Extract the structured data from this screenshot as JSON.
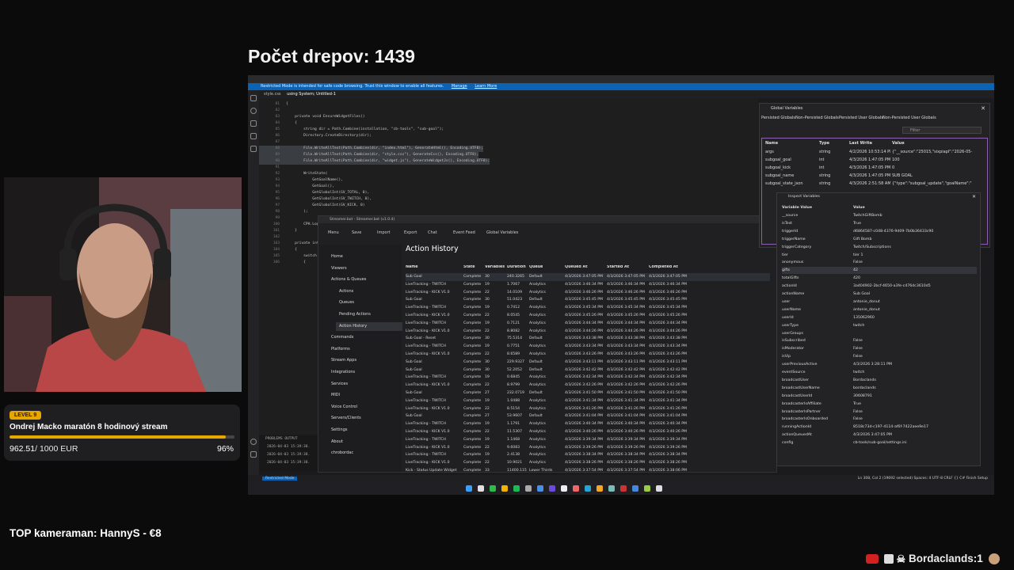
{
  "overlay": {
    "title": "Počet drepov: 1439",
    "goal": {
      "level": "LEVEL 9",
      "title": "Ondrej Macko maratón 8 hodinový stream",
      "amount": "962.51",
      "target": "/ 1000 EUR",
      "percent": "96%",
      "progress_fraction": 0.9625
    },
    "top_cameraman": "TOP kameraman: HannyS - €8",
    "chat": {
      "user": "Bordaclands",
      "count": ":1"
    }
  },
  "vscode": {
    "restricted_banner": "Restricted Mode is intended for safe code browsing. Trust this window to enable all features.",
    "banner_manage": "Manage",
    "banner_learn": "Learn More",
    "tab1": "style.css",
    "tab2": "using System; Untitled-1",
    "status_mode": "Restricted Mode",
    "status_right": "Ln 308, Col 2 (19692 selected)   Spaces: 4   UTF-8   CRLF   {} C#   Finish Setup",
    "panel_tabs": "PROBLEMS   OUTPUT",
    "code_lines": [
      {
        "n": "81",
        "t": "{"
      },
      {
        "n": "82",
        "t": ""
      },
      {
        "n": "83",
        "t": "    private void EnsureWidgetFiles()"
      },
      {
        "n": "84",
        "t": "    {"
      },
      {
        "n": "85",
        "t": "        string dir = Path.Combine(installation, \"cb-tools\", \"sub-goal\");"
      },
      {
        "n": "86",
        "t": "        Directory.CreateDirectory(dir);"
      },
      {
        "n": "87",
        "t": ""
      },
      {
        "n": "88",
        "t": "        File.WriteAllText(Path.Combine(dir, \"index.html\"), GenerateHtml(), Encoding.UTF8);"
      },
      {
        "n": "89",
        "t": "        File.WriteAllText(Path.Combine(dir, \"style.css\"), GenerateCss(), Encoding.UTF8);"
      },
      {
        "n": "90",
        "t": "        File.WriteAllText(Path.Combine(dir, \"widget.js\"), GenerateWidgetJs(), Encoding.UTF8);"
      },
      {
        "n": "91",
        "t": ""
      },
      {
        "n": "92",
        "t": "        WriteState("
      },
      {
        "n": "93",
        "t": "            GetGoalName(),"
      },
      {
        "n": "94",
        "t": "            GetGoal(),"
      },
      {
        "n": "95",
        "t": "            GetGlobalInt(GV_TOTAL, 0),"
      },
      {
        "n": "96",
        "t": "            GetGlobalInt(GV_TWITCH, 0),"
      },
      {
        "n": "97",
        "t": "            GetGlobalInt(GV_KICK, 0)"
      },
      {
        "n": "98",
        "t": "        );"
      },
      {
        "n": "99",
        "t": ""
      },
      {
        "n": "100",
        "t": "        CPH.LogInfo(\"SubGoal: widget files generated/refreshed.\");"
      },
      {
        "n": "101",
        "t": "    }"
      },
      {
        "n": "102",
        "t": ""
      },
      {
        "n": "103",
        "t": "    private int"
      },
      {
        "n": "104",
        "t": "    {"
      },
      {
        "n": "105",
        "t": "        switch"
      },
      {
        "n": "106",
        "t": "        {"
      }
    ],
    "output_lines": [
      "2026-04-03 15:39:38.",
      "2026-04-03 15:39:38.",
      "2026-04-03 15:39:38."
    ]
  },
  "global_vars": {
    "title": "Global Variables",
    "tabs": [
      "Persisted Globals",
      "Non-Persisted Globals",
      "Persisted User Globals",
      "Non-Persisted User Globals"
    ],
    "filter_placeholder": "Filter",
    "headers": [
      "Name",
      "Type",
      "Last Write",
      "Value"
    ],
    "rows": [
      {
        "name": "args",
        "type": "string",
        "last": "4/2/2026 10:53:14 PM",
        "value": "{\"__source\":\"25015,\"sixpiapl\":\"2026-05-"
      },
      {
        "name": "subgoal_goal",
        "type": "int",
        "last": "4/3/2026 1:47:05 PM",
        "value": "100"
      },
      {
        "name": "subgoal_kick",
        "type": "int",
        "last": "4/3/2026 1:47:05 PM",
        "value": "0"
      },
      {
        "name": "subgoal_name",
        "type": "string",
        "last": "4/3/2026 1:47:05 PM",
        "value": "SUB GOAL"
      },
      {
        "name": "subgoal_state_json",
        "type": "string",
        "last": "4/3/2026 2:51:58 AM",
        "value": "{\"type\":\"subgoal_update\",\"goalName\":\""
      }
    ]
  },
  "inspect_vars": {
    "title": "Inspect Variables",
    "headers": [
      "Variable Value",
      "Value"
    ],
    "rows": [
      {
        "k": "__source",
        "v": "TwitchGiftBomb"
      },
      {
        "k": "isTest",
        "v": "True"
      },
      {
        "k": "triggerId",
        "v": "d6864587-c048-4376-9d09-7b0b36433c90"
      },
      {
        "k": "triggerName",
        "v": "Gift Bomb"
      },
      {
        "k": "triggerCategory",
        "v": "Twitch/Subscriptions"
      },
      {
        "k": "tier",
        "v": "tier 1"
      },
      {
        "k": "anonymous",
        "v": "False"
      },
      {
        "k": "gifts",
        "v": "42"
      },
      {
        "k": "totalGifts",
        "v": "420"
      },
      {
        "k": "actionId",
        "v": "3a404902-2bcf-4650-a3fe-c476dc3610d5"
      },
      {
        "k": "actionName",
        "v": "Sub Goal"
      },
      {
        "k": "user",
        "v": "antonie_donut"
      },
      {
        "k": "userName",
        "v": "antonie_donut"
      },
      {
        "k": "userId",
        "v": "135062960"
      },
      {
        "k": "userType",
        "v": "twitch"
      },
      {
        "k": "userGroups",
        "v": ""
      },
      {
        "k": "isSubscribed",
        "v": "False"
      },
      {
        "k": "isModerator",
        "v": "False"
      },
      {
        "k": "isVip",
        "v": "False"
      },
      {
        "k": "userPreviousActive",
        "v": "4/3/2026 3:28:11 PM"
      },
      {
        "k": "eventSource",
        "v": "twitch"
      },
      {
        "k": "broadcastUser",
        "v": "Bordaclands"
      },
      {
        "k": "broadcastUserName",
        "v": "bordaclands"
      },
      {
        "k": "broadcastUserId",
        "v": "30608791"
      },
      {
        "k": "broadcasterIsAffiliate",
        "v": "True"
      },
      {
        "k": "broadcasterIsPartner",
        "v": "False"
      },
      {
        "k": "broadcasterIsOnboarded",
        "v": "False"
      },
      {
        "k": "runningActionId",
        "v": "8518c73d-c197-4114-af6f-7422aee9e17"
      },
      {
        "k": "actionQueuedAt",
        "v": "4/3/2026 3:47:05 PM"
      },
      {
        "k": "config",
        "v": "cb-tools/sub-goal/settings.ini"
      }
    ]
  },
  "streamerbot": {
    "window_title": "Streamer.bot - Streamer.bot (v1.0.4)",
    "toolbar": [
      "Menu",
      "Save",
      "Import",
      "Export",
      "Chat",
      "Event Feed",
      "Global Variables"
    ],
    "nav": [
      {
        "label": "Home",
        "indent": 0
      },
      {
        "label": "Viewers",
        "indent": 0
      },
      {
        "label": "Actions & Queues",
        "indent": 0
      },
      {
        "label": "Actions",
        "indent": 1
      },
      {
        "label": "Queues",
        "indent": 1
      },
      {
        "label": "Pending Actions",
        "indent": 1
      },
      {
        "label": "Action History",
        "indent": 1,
        "selected": true
      },
      {
        "label": "Commands",
        "indent": 0
      },
      {
        "label": "Platforms",
        "indent": 0
      },
      {
        "label": "Stream Apps",
        "indent": 0
      },
      {
        "label": "Integrations",
        "indent": 0
      },
      {
        "label": "Services",
        "indent": 0
      },
      {
        "label": "MIDI",
        "indent": 0
      },
      {
        "label": "Voice Control",
        "indent": 0
      },
      {
        "label": "Servers/Clients",
        "indent": 0
      },
      {
        "label": "Settings",
        "indent": 0
      },
      {
        "label": "About",
        "indent": 0
      },
      {
        "label": "chrobordac",
        "indent": 0
      }
    ],
    "page_title": "Action History",
    "headers": [
      "Name",
      "State",
      "Variables",
      "Duration",
      "Queue",
      "Queued At",
      "Started At",
      "Completed At"
    ],
    "rows": [
      [
        "Sub Goal",
        "Complete",
        "30",
        "240.3265",
        "Default",
        "4/3/2026 3:47:05 PM",
        "4/3/2026 3:47:05 PM",
        "4/3/2026 3:47:05 PM"
      ],
      [
        "LiveTracking - TWITCH",
        "Complete",
        "19",
        "1.7067",
        "Analytics",
        "4/3/2026 3:46:34 PM",
        "4/3/2026 3:46:34 PM",
        "4/3/2026 3:46:34 PM"
      ],
      [
        "LiveTracking - KICK V1.0",
        "Complete",
        "22",
        "14.0109",
        "Analytics",
        "4/3/2026 3:46:26 PM",
        "4/3/2026 3:46:26 PM",
        "4/3/2026 3:46:26 PM"
      ],
      [
        "Sub Goal",
        "Complete",
        "30",
        "51.0423",
        "Default",
        "4/3/2026 3:45:45 PM",
        "4/3/2026 3:45:45 PM",
        "4/3/2026 3:45:45 PM"
      ],
      [
        "LiveTracking - TWITCH",
        "Complete",
        "19",
        "0.7412",
        "Analytics",
        "4/3/2026 3:45:34 PM",
        "4/3/2026 3:45:34 PM",
        "4/3/2026 3:45:34 PM"
      ],
      [
        "LiveTracking - KICK V1.0",
        "Complete",
        "22",
        "8.0545",
        "Analytics",
        "4/3/2026 3:45:26 PM",
        "4/3/2026 3:45:26 PM",
        "4/3/2026 3:45:26 PM"
      ],
      [
        "LiveTracking - TWITCH",
        "Complete",
        "19",
        "0.7121",
        "Analytics",
        "4/3/2026 3:44:34 PM",
        "4/3/2026 3:44:34 PM",
        "4/3/2026 3:44:34 PM"
      ],
      [
        "LiveTracking - KICK V1.0",
        "Complete",
        "22",
        "8.8082",
        "Analytics",
        "4/3/2026 3:44:26 PM",
        "4/3/2026 3:44:26 PM",
        "4/3/2026 3:44:26 PM"
      ],
      [
        "Sub Goal - Reset",
        "Complete",
        "30",
        "75.5314",
        "Default",
        "4/3/2026 3:43:38 PM",
        "4/3/2026 3:43:38 PM",
        "4/3/2026 3:43:38 PM"
      ],
      [
        "LiveTracking - TWITCH",
        "Complete",
        "19",
        "0.7751",
        "Analytics",
        "4/3/2026 3:43:34 PM",
        "4/3/2026 3:43:34 PM",
        "4/3/2026 3:43:34 PM"
      ],
      [
        "LiveTracking - KICK V1.0",
        "Complete",
        "22",
        "8.6589",
        "Analytics",
        "4/3/2026 3:43:26 PM",
        "4/3/2026 3:43:26 PM",
        "4/3/2026 3:43:26 PM"
      ],
      [
        "Sub Goal",
        "Complete",
        "30",
        "229.9327",
        "Default",
        "4/3/2026 3:43:11 PM",
        "4/3/2026 3:43:11 PM",
        "4/3/2026 3:43:11 PM"
      ],
      [
        "Sub Goal",
        "Complete",
        "30",
        "52.2052",
        "Default",
        "4/3/2026 3:42:42 PM",
        "4/3/2026 3:42:42 PM",
        "4/3/2026 3:42:42 PM"
      ],
      [
        "LiveTracking - TWITCH",
        "Complete",
        "19",
        "0.6845",
        "Analytics",
        "4/3/2026 3:42:34 PM",
        "4/3/2026 3:42:34 PM",
        "4/3/2026 3:42:34 PM"
      ],
      [
        "LiveTracking - KICK V1.0",
        "Complete",
        "22",
        "8.9799",
        "Analytics",
        "4/3/2026 3:42:26 PM",
        "4/3/2026 3:42:26 PM",
        "4/3/2026 3:42:26 PM"
      ],
      [
        "Sub Goal",
        "Complete",
        "27",
        "232.0719",
        "Default",
        "4/3/2026 3:41:50 PM",
        "4/3/2026 3:41:50 PM",
        "4/3/2026 3:41:50 PM"
      ],
      [
        "LiveTracking - TWITCH",
        "Complete",
        "19",
        "1.0488",
        "Analytics",
        "4/3/2026 3:41:34 PM",
        "4/3/2026 3:41:34 PM",
        "4/3/2026 3:41:34 PM"
      ],
      [
        "LiveTracking - KICK V1.0",
        "Complete",
        "22",
        "8.5154",
        "Analytics",
        "4/3/2026 3:41:26 PM",
        "4/3/2026 3:41:26 PM",
        "4/3/2026 3:41:26 PM"
      ],
      [
        "Sub Goal",
        "Complete",
        "27",
        "53.9607",
        "Default",
        "4/3/2026 3:41:04 PM",
        "4/3/2026 3:41:04 PM",
        "4/3/2026 3:41:04 PM"
      ],
      [
        "LiveTracking - TWITCH",
        "Complete",
        "19",
        "1.1791",
        "Analytics",
        "4/3/2026 3:40:34 PM",
        "4/3/2026 3:40:34 PM",
        "4/3/2026 3:40:34 PM"
      ],
      [
        "LiveTracking - KICK V1.0",
        "Complete",
        "22",
        "11.5307",
        "Analytics",
        "4/3/2026 3:40:26 PM",
        "4/3/2026 3:40:26 PM",
        "4/3/2026 3:40:26 PM"
      ],
      [
        "LiveTracking - TWITCH",
        "Complete",
        "19",
        "1.1468",
        "Analytics",
        "4/3/2026 3:39:34 PM",
        "4/3/2026 3:39:34 PM",
        "4/3/2026 3:39:34 PM"
      ],
      [
        "LiveTracking - KICK V1.0",
        "Complete",
        "22",
        "9.6083",
        "Analytics",
        "4/3/2026 3:39:26 PM",
        "4/3/2026 3:39:26 PM",
        "4/3/2026 3:39:26 PM"
      ],
      [
        "LiveTracking - TWITCH",
        "Complete",
        "19",
        "2.4138",
        "Analytics",
        "4/3/2026 3:38:34 PM",
        "4/3/2026 3:38:34 PM",
        "4/3/2026 3:38:34 PM"
      ],
      [
        "LiveTracking - KICK V1.0",
        "Complete",
        "22",
        "10.9021",
        "Analytics",
        "4/3/2026 3:38:26 PM",
        "4/3/2026 3:38:26 PM",
        "4/3/2026 3:38:26 PM"
      ],
      [
        "Kick - Status Update Widget",
        "Complete",
        "33",
        "11400.115",
        "Lower Thirds",
        "4/3/2026 3:37:54 PM",
        "4/3/2026 3:37:54 PM",
        "4/3/2026 3:38:06 PM"
      ]
    ]
  },
  "colors": {
    "accent": "#e6a800",
    "vscode_blue": "#0b63b6"
  }
}
